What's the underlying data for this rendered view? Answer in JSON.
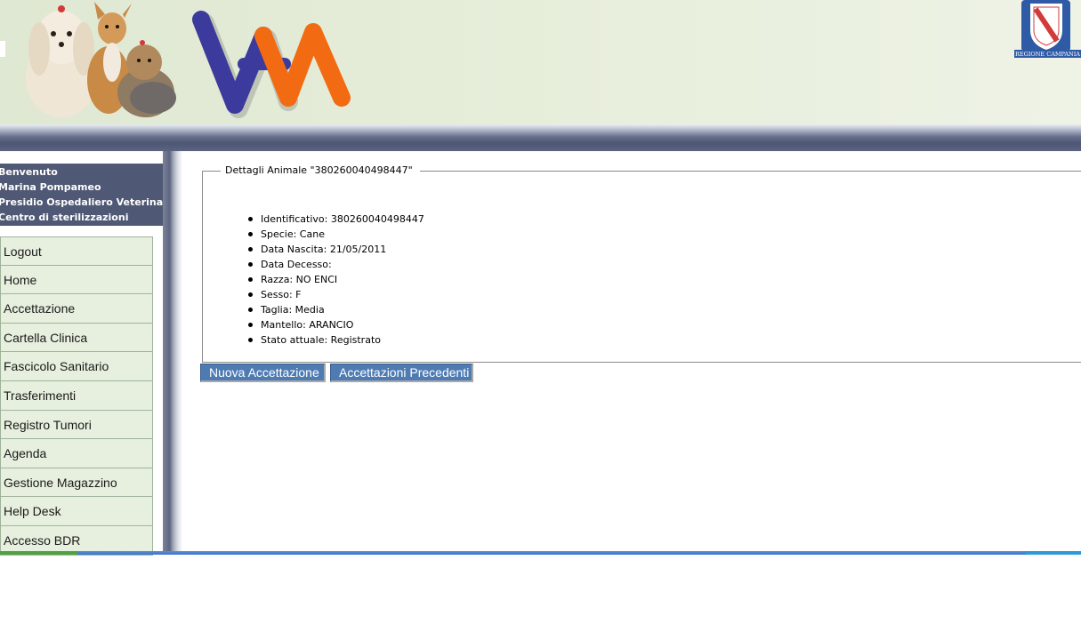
{
  "header": {
    "logo_text": "VAM",
    "crest_caption": "REGIONE CAMPANIA"
  },
  "sidebar": {
    "welcome": {
      "greeting": "Benvenuto",
      "user_name": "Marina Pompameo",
      "role": "Presidio Ospedaliero Veterinario",
      "center": "Centro di sterilizzazioni"
    },
    "menu": [
      "Logout",
      "Home",
      "Accettazione",
      "Cartella Clinica",
      "Fascicolo Sanitario",
      "Trasferimenti",
      "Registro Tumori",
      "Agenda",
      "Gestione Magazzino",
      "Help Desk",
      "Accesso BDR"
    ]
  },
  "details": {
    "legend": "Dettagli Animale \"380260040498447\"",
    "fields": [
      "Identificativo: 380260040498447",
      "Specie: Cane",
      "Data Nascita: 21/05/2011",
      "Data Decesso:",
      "Razza: NO ENCI",
      "Sesso: F",
      "Taglia: Media",
      "Mantello: ARANCIO",
      "Stato attuale: Registrato"
    ]
  },
  "buttons": {
    "new_acceptance": "Nuova Accettazione",
    "previous_acceptances": "Accettazioni Precedenti"
  },
  "colors": {
    "logo_blue": "#3c3a9c",
    "logo_orange": "#f26b12",
    "sidebar_dark": "#4f5874",
    "menu_bg": "#e7f0df",
    "button_blue": "#4f7bb3"
  }
}
